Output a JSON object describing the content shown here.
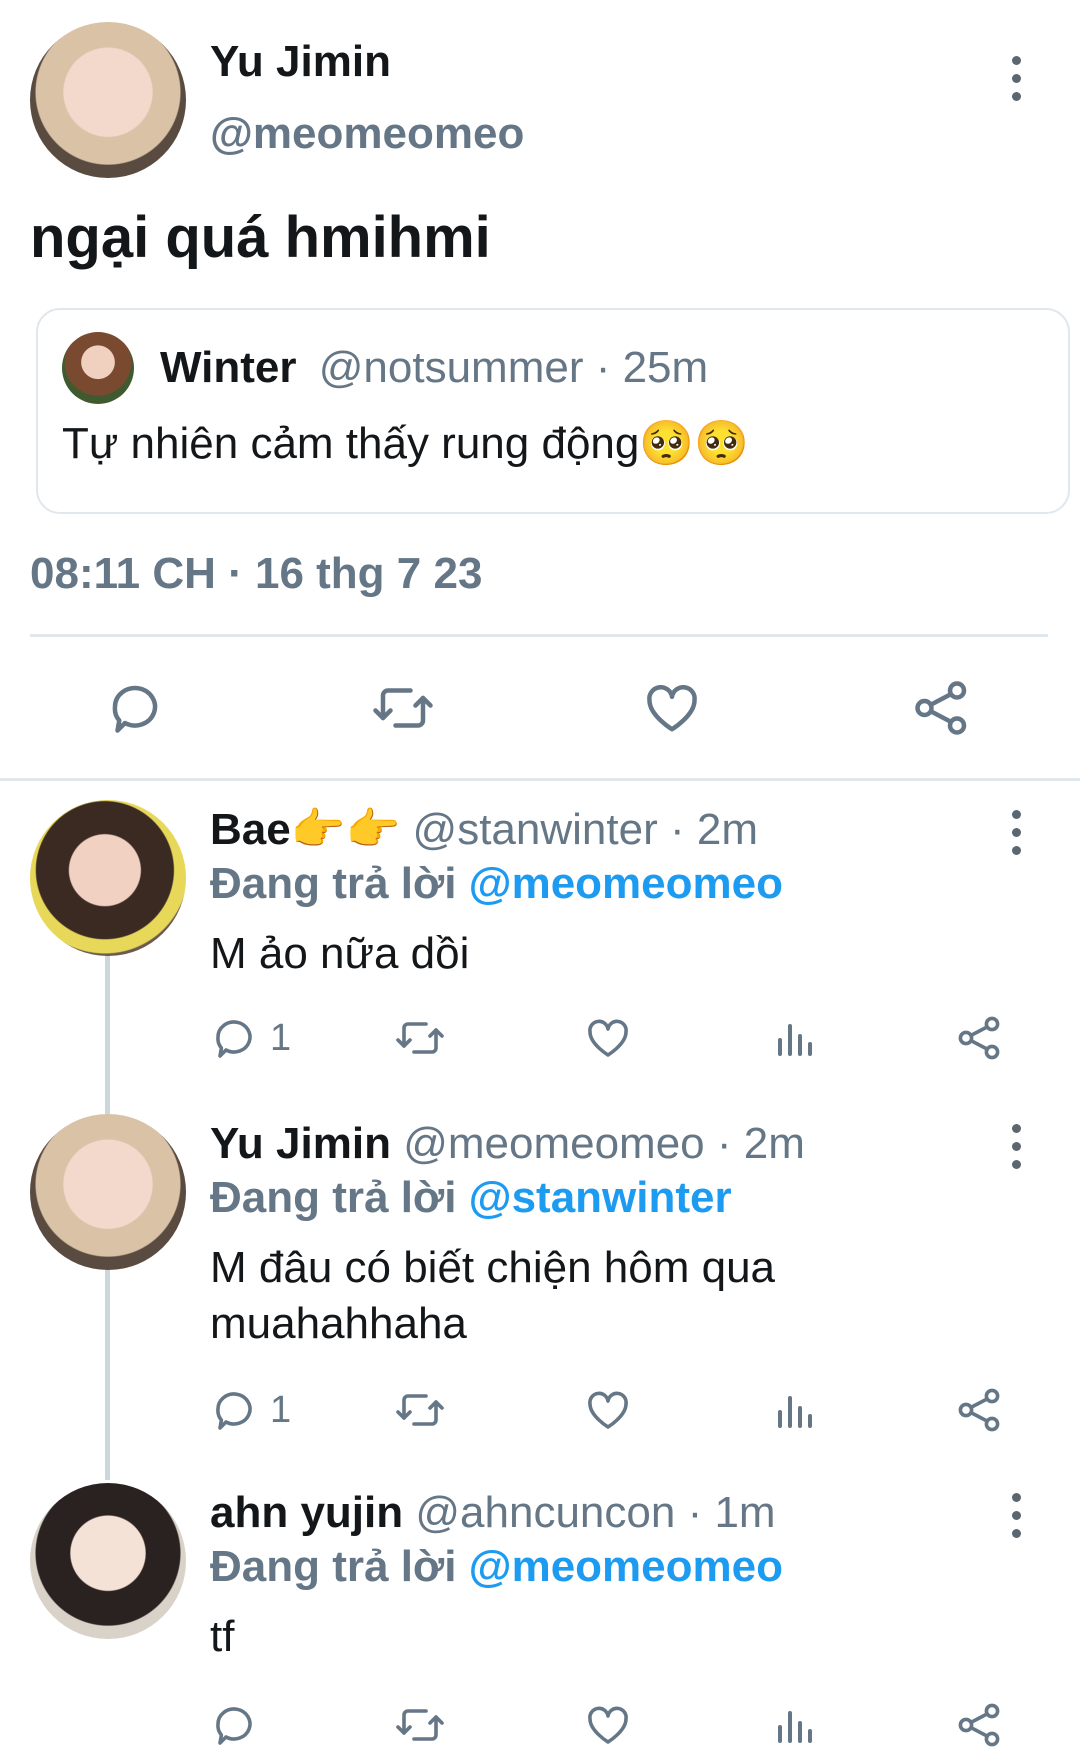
{
  "main_tweet": {
    "author_name": "Yu Jimin",
    "author_handle": "@meomeomeo",
    "text": "ngại quá hmihmi",
    "quoted": {
      "author_name": "Winter",
      "author_handle": "@notsummer",
      "time": "· 25m",
      "text": "Tự nhiên cảm thấy rung động",
      "emoji": "🥺🥺"
    },
    "timestamp": "08:11 CH · 16 thg 7 23"
  },
  "replies": [
    {
      "name": "Bae",
      "name_emoji": "👉👉",
      "handle": "@stanwinter",
      "time": "· 2m",
      "replying_label": "Đang trả lời",
      "replying_to": "@meomeomeo",
      "text_line1": "M ảo nữa dồi",
      "text_line2": "",
      "reply_count": "1"
    },
    {
      "name": "Yu Jimin",
      "name_emoji": "",
      "handle": "@meomeomeo",
      "time": "· 2m",
      "replying_label": "Đang trả lời",
      "replying_to": "@stanwinter",
      "text_line1": "M đâu có biết chiện hôm qua",
      "text_line2": "muahahhaha",
      "reply_count": "1"
    },
    {
      "name": "ahn yujin",
      "name_emoji": "",
      "handle": "@ahncuncon",
      "time": "· 1m",
      "replying_label": "Đang trả lời",
      "replying_to": "@meomeomeo",
      "text_line1": "tf",
      "text_line2": "",
      "reply_count": ""
    }
  ],
  "colors": {
    "accent": "#1d9bf0",
    "muted": "#657786",
    "text": "#14171a",
    "divider": "#e1e8ed"
  }
}
